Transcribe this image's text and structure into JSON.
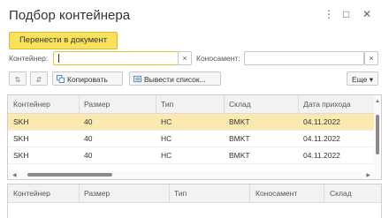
{
  "window": {
    "title": "Подбор контейнера",
    "menu_icon": "kebab-menu-icon",
    "maximize_icon": "maximize-icon",
    "close_icon": "close-icon"
  },
  "toolbar": {
    "primary_label": "Перенести в документ"
  },
  "filters": {
    "container_label": "Контейнер:",
    "container_value": "",
    "consignment_label": "Коносамент:",
    "consignment_value": ""
  },
  "actions": {
    "sort_asc_icon": "sort-ascending-icon",
    "sort_desc_icon": "sort-descending-icon",
    "copy_label": "Копировать",
    "export_label": "Вывести список...",
    "more_label": "Еще ▾"
  },
  "main_table": {
    "columns": [
      "Контейнер",
      "Размер",
      "Тип",
      "Склад",
      "Дата прихода"
    ],
    "rows": [
      {
        "container": "SKH",
        "size": "40",
        "type": "HC",
        "warehouse": "BMKT",
        "date": "04.11.2022"
      },
      {
        "container": "SKH",
        "size": "40",
        "type": "HC",
        "warehouse": "BMKT",
        "date": "04.11.2022"
      },
      {
        "container": "SKH",
        "size": "40",
        "type": "HC",
        "warehouse": "BMKT",
        "date": "04.11.2022"
      }
    ],
    "selected_row": 0
  },
  "bottom_table": {
    "columns": [
      "Контейнер",
      "Размер",
      "Тип",
      "Коносамент",
      "Склад"
    ]
  },
  "colors": {
    "accent": "#f8e25b",
    "selected_row": "#fbe9b0"
  }
}
